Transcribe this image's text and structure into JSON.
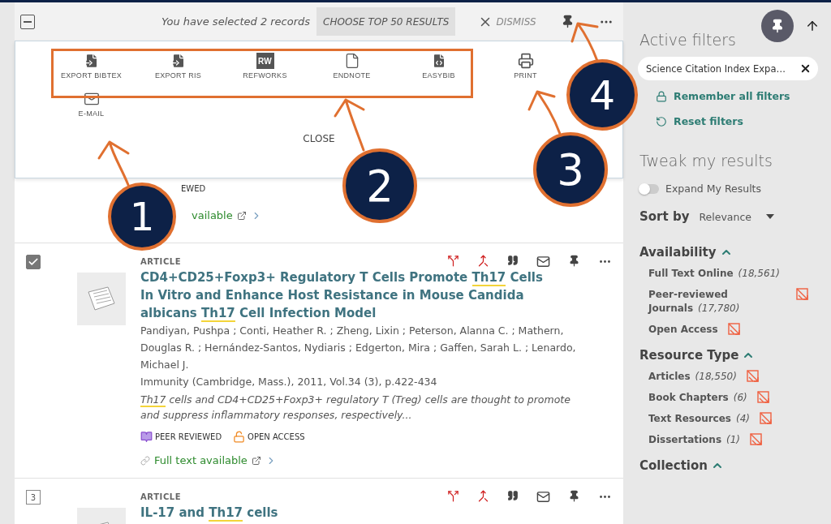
{
  "selection_bar": {
    "indeterminate": true,
    "message": "You have selected 2 records",
    "choose_button": "CHOOSE TOP 50 RESULTS",
    "dismiss": "DISMISS"
  },
  "export_panel": {
    "actions": [
      {
        "label": "EXPORT BIBTEX",
        "kind": "export"
      },
      {
        "label": "EXPORT RIS",
        "kind": "export"
      },
      {
        "label": "REFWORKS",
        "kind": "refworks",
        "badge": "RW"
      },
      {
        "label": "ENDNOTE",
        "kind": "file"
      },
      {
        "label": "EASYBIB",
        "kind": "easybib"
      },
      {
        "label": "PRINT",
        "kind": "print"
      },
      {
        "label": "E-MAIL",
        "kind": "mail"
      }
    ],
    "close": "CLOSE"
  },
  "records": [
    {
      "kind": "partial",
      "badge": "EWED",
      "full_text": "vailable"
    },
    {
      "kind": "full",
      "checked": true,
      "type": "ARTICLE",
      "title": [
        {
          "text": "CD4+CD25+Foxp3+ Regulatory T Cells Promote ",
          "highlight": false
        },
        {
          "text": "Th17",
          "highlight": true
        },
        {
          "text": " Cells In Vitro and Enhance Host Resistance in Mouse Candida albicans ",
          "highlight": false
        },
        {
          "text": "Th17",
          "highlight": true
        },
        {
          "text": " Cell Infection Model",
          "highlight": false
        }
      ],
      "authors": "Pandiyan, Pushpa ; Conti, Heather R. ; Zheng, Lixin ; Peterson, Alanna C. ; Mathern, Douglas R. ; Hernández-Santos, Nydiaris ; Edgerton, Mira ; Gaffen, Sarah L. ; Lenardo, Michael J.",
      "source": "Immunity (Cambridge, Mass.), 2011, Vol.34 (3), p.422-434",
      "snippet": [
        {
          "text": "Th17",
          "highlight": true
        },
        {
          "text": " cells and CD4+CD25+Foxp3+ regulatory T (Treg) cells are thought to promote and suppress inflammatory responses, respectively...",
          "highlight": false
        }
      ],
      "badges": [
        {
          "label": "PEER REVIEWED",
          "kind": "peer"
        },
        {
          "label": "OPEN ACCESS",
          "kind": "open"
        }
      ],
      "full_text": "Full text available"
    },
    {
      "kind": "cut",
      "number": "3",
      "type": "ARTICLE",
      "title": [
        {
          "text": "IL-17 and ",
          "highlight": false
        },
        {
          "text": "Th17",
          "highlight": true
        },
        {
          "text": " cells",
          "highlight": false
        }
      ]
    }
  ],
  "sidebar": {
    "active_filters_title": "Active filters",
    "chip": "Science Citation Index Expa…",
    "remember": "Remember all filters",
    "reset": "Reset filters",
    "tweak_title": "Tweak my results",
    "toggle": {
      "label": "Expand My Results",
      "on": false
    },
    "sort": {
      "label": "Sort by",
      "value": "Relevance"
    },
    "facets": [
      {
        "title": "Availability",
        "expanded": true,
        "items": [
          {
            "label": "Full Text Online",
            "count": "(18,561)",
            "exclude_icon": false
          },
          {
            "label": "Peer-reviewed Journals",
            "count": "(17,780)",
            "exclude_icon": true
          },
          {
            "label": "Open Access",
            "exclude_icon": true
          }
        ]
      },
      {
        "title": "Resource Type",
        "expanded": true,
        "items": [
          {
            "label": "Articles",
            "count": "(18,550)",
            "exclude_icon": true
          },
          {
            "label": "Book Chapters",
            "count": "(6)",
            "exclude_icon": true
          },
          {
            "label": "Text Resources",
            "count": "(4)",
            "exclude_icon": true
          },
          {
            "label": "Dissertations",
            "count": "(1)",
            "exclude_icon": true
          }
        ]
      },
      {
        "title": "Collection",
        "expanded": true
      }
    ]
  },
  "annotations": [
    {
      "label": "1"
    },
    {
      "label": "2"
    },
    {
      "label": "3"
    },
    {
      "label": "4"
    }
  ]
}
